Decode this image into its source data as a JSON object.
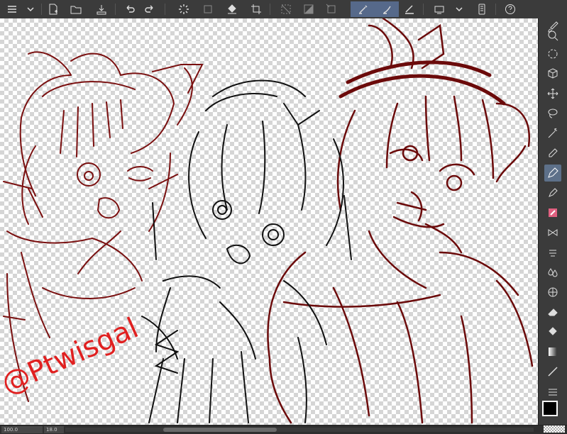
{
  "toolbar": {
    "items": [
      "menu-icon",
      "chevron-down-icon",
      "new-canvas-icon",
      "open-folder-icon",
      "export-icon",
      "undo-icon",
      "redo-icon",
      "loading-icon",
      "layer-fill-icon",
      "fill-icon",
      "crop-icon",
      "clear-selection-icon",
      "invert-selection-icon",
      "transform-icon",
      "brush-pen-icon",
      "brush-pen-active-icon",
      "pen-settings-icon",
      "display-settings-icon",
      "chevron-down-icon",
      "tablet-icon",
      "help-icon"
    ]
  },
  "sidebar": {
    "tools": [
      "paintbrush-icon",
      "zoom-icon",
      "rotate-view-icon",
      "cube-icon",
      "move-icon",
      "lasso-icon",
      "magic-wand-icon",
      "eyedropper-icon",
      "pen-icon",
      "pencil-icon",
      "brush-icon",
      "airbrush-icon",
      "blend-icon",
      "droplets-icon",
      "grid-icon",
      "eraser-icon",
      "fill-bucket-icon",
      "gradient-icon",
      "line-icon",
      "layers-icon"
    ],
    "main_color": "#000000"
  },
  "signature": {
    "text": "@Ptwisgal",
    "color": "#e02020"
  },
  "colors": {
    "sketch_red": "#7a1010",
    "sketch_black": "#111111"
  },
  "status": {
    "zoom_left": "100.0",
    "zoom_right": "18.0"
  }
}
